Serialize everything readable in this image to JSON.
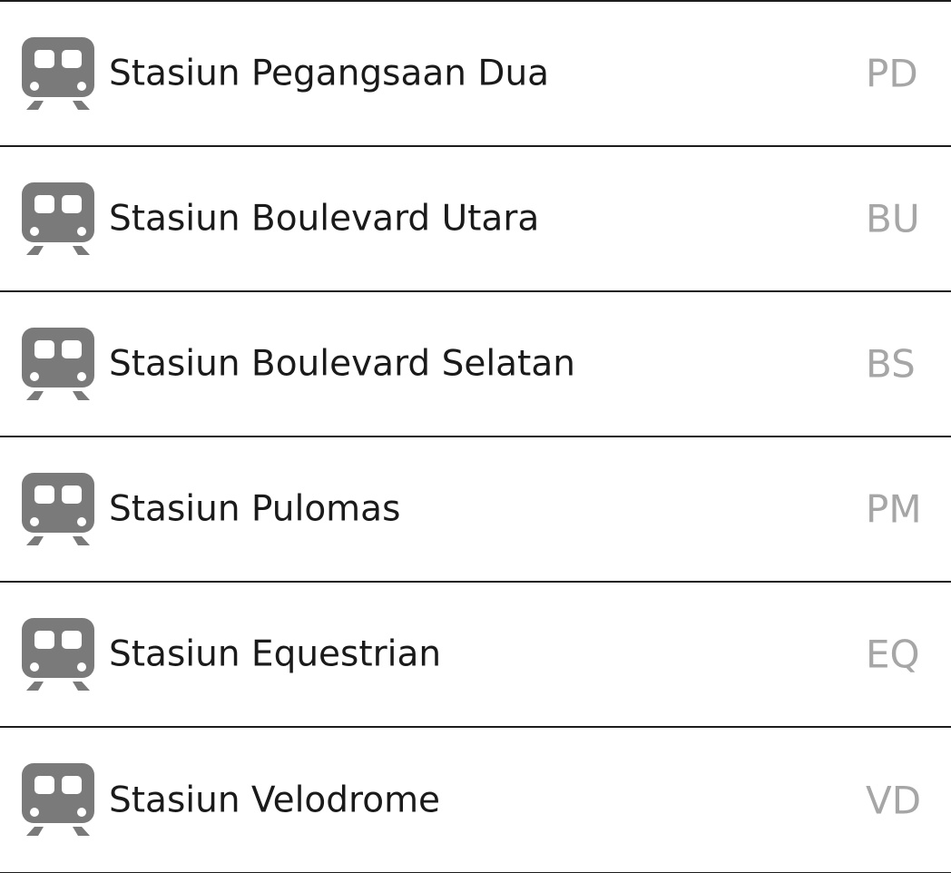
{
  "stations": [
    {
      "name": "Stasiun Pegangsaan Dua",
      "code": "PD",
      "icon": "train-icon"
    },
    {
      "name": "Stasiun Boulevard Utara",
      "code": "BU",
      "icon": "train-icon"
    },
    {
      "name": "Stasiun Boulevard Selatan",
      "code": "BS",
      "icon": "train-icon"
    },
    {
      "name": "Stasiun Pulomas",
      "code": "PM",
      "icon": "train-icon"
    },
    {
      "name": "Stasiun Equestrian",
      "code": "EQ",
      "icon": "train-icon"
    },
    {
      "name": "Stasiun Velodrome",
      "code": "VD",
      "icon": "train-icon"
    }
  ],
  "colors": {
    "icon": "#7a7a7a",
    "name_text": "#1a1a1a",
    "code_text": "#a6a6a6",
    "divider": "#1c1c1c",
    "background": "#ffffff"
  }
}
